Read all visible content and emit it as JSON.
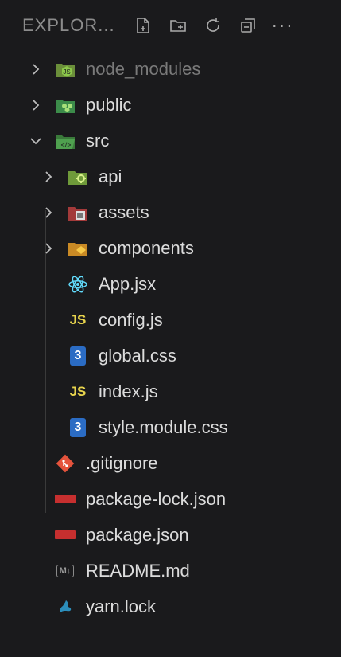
{
  "header": {
    "title": "EXPLOR...",
    "more": "···"
  },
  "icons": {
    "new_file": "new-file-icon",
    "new_folder": "new-folder-icon",
    "refresh": "refresh-icon",
    "collapse": "collapse-all-icon"
  },
  "items": [
    {
      "label": "node_modules",
      "type": "folder",
      "state": "collapsed",
      "level": 0,
      "icon": "node-folder-icon",
      "dim": true
    },
    {
      "label": "public",
      "type": "folder",
      "state": "collapsed",
      "level": 0,
      "icon": "public-folder-icon"
    },
    {
      "label": "src",
      "type": "folder",
      "state": "expanded",
      "level": 0,
      "icon": "src-folder-icon"
    },
    {
      "label": "api",
      "type": "folder",
      "state": "collapsed",
      "level": 1,
      "icon": "api-folder-icon"
    },
    {
      "label": "assets",
      "type": "folder",
      "state": "collapsed",
      "level": 1,
      "icon": "assets-folder-icon"
    },
    {
      "label": "components",
      "type": "folder",
      "state": "collapsed",
      "level": 1,
      "icon": "components-folder-icon"
    },
    {
      "label": "App.jsx",
      "type": "file",
      "level": 1,
      "icon": "react-icon"
    },
    {
      "label": "config.js",
      "type": "file",
      "level": 1,
      "icon": "javascript-icon",
      "badge": "JS"
    },
    {
      "label": "global.css",
      "type": "file",
      "level": 1,
      "icon": "css-icon",
      "badge": "3"
    },
    {
      "label": "index.js",
      "type": "file",
      "level": 1,
      "icon": "javascript-icon",
      "badge": "JS"
    },
    {
      "label": "style.module.css",
      "type": "file",
      "level": 1,
      "icon": "css-icon",
      "badge": "3"
    },
    {
      "label": ".gitignore",
      "type": "file",
      "level": 0,
      "icon": "git-icon"
    },
    {
      "label": "package-lock.json",
      "type": "file",
      "level": 0,
      "icon": "npm-icon"
    },
    {
      "label": "package.json",
      "type": "file",
      "level": 0,
      "icon": "npm-icon"
    },
    {
      "label": "README.md",
      "type": "file",
      "level": 0,
      "icon": "markdown-icon",
      "badge": "M↓"
    },
    {
      "label": "yarn.lock",
      "type": "file",
      "level": 0,
      "icon": "yarn-icon"
    }
  ],
  "colors": {
    "background": "#1a1a1c",
    "js": "#e8d44d",
    "css": "#2b6cc4",
    "npm": "#c62f2f",
    "git": "#e5533c",
    "react": "#61dafb",
    "yarn": "#2c8ebb"
  }
}
